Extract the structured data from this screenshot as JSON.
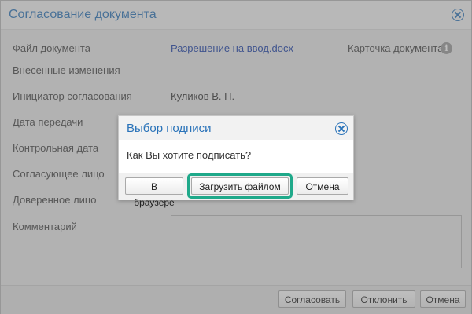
{
  "window": {
    "title": "Согласование документа"
  },
  "form": {
    "labels": {
      "file": "Файл документа",
      "changes": "Внесенные изменения",
      "initiator": "Инициатор согласования",
      "transfer_date": "Дата передачи",
      "control_date": "Контрольная дата",
      "approver": "Согласующее лицо",
      "trusted": "Доверенное лицо",
      "comment": "Комментарий"
    },
    "file_link": "Разрешение на ввод.docx",
    "card_link": "Карточка документа",
    "initiator_value": "Куликов В. П.",
    "comment_value": ""
  },
  "footer": {
    "approve_label": "Согласовать",
    "reject_label": "Отклонить",
    "cancel_label": "Отмена"
  },
  "modal": {
    "title": "Выбор подписи",
    "question": "Как Вы хотите подписать?",
    "browser_label": "В браузере",
    "upload_label": "Загрузить файлом",
    "cancel_label": "Отмена"
  },
  "colors": {
    "accent": "#2a73b9",
    "link": "#1a3fa8",
    "highlight": "#1fa98a"
  }
}
